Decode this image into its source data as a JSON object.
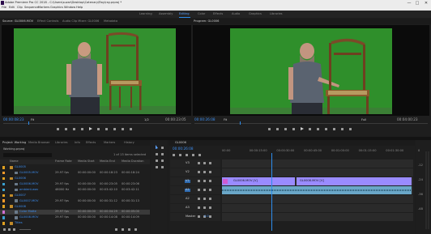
{
  "title_bar": {
    "app_title": "Adobe Premiere Pro CC 2018 - C:\\Users\\suzar\\Desktop\\Catenary\\Ray\\ray.prproj *",
    "min_label": "—",
    "max_label": "□",
    "close_label": "✕"
  },
  "menu": [
    "File",
    "Edit",
    "Clip",
    "Sequence",
    "Markers",
    "Graphics",
    "Window",
    "Help"
  ],
  "workspaces": [
    "Learning",
    "Assembly",
    "Editing",
    "Color",
    "Effects",
    "Audio",
    "Graphics",
    "Libraries"
  ],
  "source_panel": {
    "tabs": [
      "Source: GL0006.MOV",
      "Effect Controls",
      "Audio Clip Mixer: GL0006",
      "Metadata"
    ],
    "timecode_left": "00:00:08:23",
    "zoom": "Fit",
    "ratio": "1/2",
    "timecode_right": "00:00:23:05"
  },
  "program_panel": {
    "tabs": [
      "Program: GL0006"
    ],
    "timecode_left": "00:00:26:08",
    "zoom": "Fit",
    "ratio": "Full",
    "timecode_right": "00:04:00:23"
  },
  "project_panel": {
    "tabs": [
      "Project: Working",
      "Media Browser",
      "Libraries",
      "Info",
      "Effects",
      "Markers",
      "History"
    ],
    "project_file": "Working.prproj",
    "search_placeholder": "",
    "item_count": "1 of 13 items selected",
    "columns": [
      "Name",
      "Frame Rate",
      "Media Start",
      "Media End",
      "Media Duration"
    ],
    "rows": [
      {
        "name": "GL0005",
        "rate": "",
        "start": "",
        "end": "",
        "dur": "",
        "color": "#e0a020",
        "indent": 0,
        "folder": true
      },
      {
        "name": "GL0005.MOV",
        "rate": "29.97 fps",
        "start": "00:00:00:00",
        "end": "00:00:18:23",
        "dur": "00:00:18:24",
        "color": "#ff9a2a",
        "indent": 1,
        "folder": false
      },
      {
        "name": "GL0006",
        "rate": "",
        "start": "",
        "end": "",
        "dur": "",
        "color": "#e0a020",
        "indent": 0,
        "folder": true
      },
      {
        "name": "GL0006.MOV",
        "rate": "29.97 fps",
        "start": "00:00:00:00",
        "end": "00:00:23:05",
        "dur": "00:00:23:06",
        "color": "#3aa0d0",
        "indent": 1,
        "folder": false
      },
      {
        "name": "ambient.wav",
        "rate": "48000 Hz",
        "start": "00:00:00:00",
        "end": "00:03:42:10",
        "dur": "00:03:42:11",
        "color": "#3aa0d0",
        "indent": 1,
        "folder": false
      },
      {
        "name": "GL0007",
        "rate": "",
        "start": "",
        "end": "",
        "dur": "",
        "color": "#e0a020",
        "indent": 0,
        "folder": true
      },
      {
        "name": "GL0007.MOV",
        "rate": "29.97 fps",
        "start": "00:00:00:00",
        "end": "00:00:31:12",
        "dur": "00:00:31:13",
        "color": "#ff9a2a",
        "indent": 1,
        "folder": false
      },
      {
        "name": "GL0008",
        "rate": "",
        "start": "",
        "end": "",
        "dur": "",
        "color": "#e0a020",
        "indent": 0,
        "folder": true
      },
      {
        "name": "Color Matte",
        "rate": "29.97 fps",
        "start": "00:00:00:00",
        "end": "00:00:04:29",
        "dur": "00:00:05:00",
        "color": "#d070d0",
        "indent": 1,
        "folder": false
      },
      {
        "name": "GL0008.MOV",
        "rate": "29.97 fps",
        "start": "00:00:00:00",
        "end": "00:00:14:08",
        "dur": "00:00:14:09",
        "color": "#3aa0d0",
        "indent": 1,
        "folder": false
      },
      {
        "name": "Titles",
        "rate": "",
        "start": "",
        "end": "",
        "dur": "",
        "color": "#e0a020",
        "indent": 0,
        "folder": true
      }
    ]
  },
  "timeline": {
    "tab": "GL0006",
    "timecode": "00:00:26:08",
    "ruler": [
      "00:00",
      "00:00:15:00",
      "00:00:30:00",
      "00:00:45:00",
      "00:01:00:00",
      "00:01:15:00",
      "00:01:30:00"
    ],
    "tracks": [
      "V3",
      "V2",
      "V1",
      "A1",
      "A2",
      "A3",
      "Master"
    ],
    "master_value": "0.0",
    "clip_v1": "GL0006.MOV [V]",
    "clip_v1b": "GL0008.MOV [V]",
    "clip_a1": "",
    "playhead_fraction": 0.26
  },
  "meters": [
    "0",
    "-12",
    "-24",
    "-36",
    "-48"
  ],
  "colors": {
    "accent": "#2d8ceb",
    "green_screen": "#2f8b2c",
    "clip_video": "#9a8bff",
    "clip_audio": "#6aa7c8"
  }
}
